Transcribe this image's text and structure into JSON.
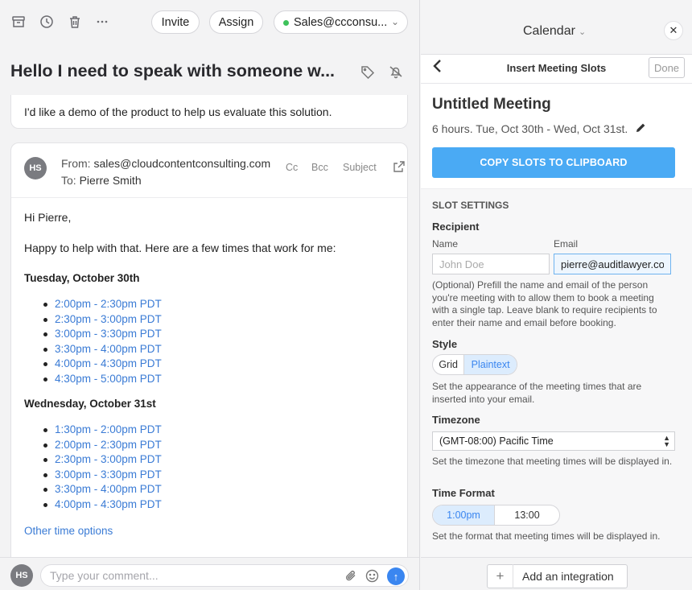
{
  "toolbar": {
    "archive_icon": "archive-icon",
    "snooze_icon": "clock-icon",
    "trash_icon": "trash-icon",
    "more_icon": "ellipsis-icon",
    "invite_label": "Invite",
    "assign_label": "Assign",
    "inbox_label": "Sales@ccconsu...",
    "inbox_status_color": "#3ec25b"
  },
  "conversation": {
    "subject": "Hello I need to speak with someone w...",
    "previous_message": "I'd like a demo of the product to help us evaluate this solution."
  },
  "message": {
    "avatar_initials": "HS",
    "from_label": "From:",
    "from_value": "sales@cloudcontentconsulting.com",
    "to_label": "To:",
    "to_value": "Pierre Smith",
    "cc_label": "Cc",
    "bcc_label": "Bcc",
    "subject_label": "Subject",
    "greeting": "Hi Pierre,",
    "intro": "Happy to help with that. Here are a few times that work for me:",
    "days": [
      {
        "title": "Tuesday, October 30th",
        "slots": [
          "2:00pm - 2:30pm PDT",
          "2:30pm - 3:00pm PDT",
          "3:00pm - 3:30pm PDT",
          "3:30pm - 4:00pm PDT",
          "4:00pm - 4:30pm PDT",
          "4:30pm - 5:00pm PDT"
        ]
      },
      {
        "title": "Wednesday, October 31st",
        "slots": [
          "1:30pm - 2:00pm PDT",
          "2:00pm - 2:30pm PDT",
          "2:30pm - 3:00pm PDT",
          "3:00pm - 3:30pm PDT",
          "3:30pm - 4:00pm PDT",
          "4:00pm - 4:30pm PDT"
        ]
      }
    ],
    "other_options": "Other time options"
  },
  "comment": {
    "avatar_initials": "HS",
    "placeholder": "Type your comment..."
  },
  "calendar": {
    "title": "Calendar",
    "subheader_title": "Insert Meeting Slots",
    "done_label": "Done",
    "meeting_title": "Untitled Meeting",
    "meeting_when": "6 hours. Tue, Oct 30th - Wed, Oct 31st.",
    "copy_button": "COPY SLOTS TO CLIPBOARD",
    "accent_color": "#4aaaf4",
    "slot_settings_heading": "SLOT SETTINGS",
    "recipient_label": "Recipient",
    "name_label": "Name",
    "name_placeholder": "John Doe",
    "email_label": "Email",
    "email_value": "pierre@auditlawyer.co",
    "recipient_help": "(Optional) Prefill the name and email of the person you're meeting with to allow them to book a meeting with a single tap. Leave blank to require recipients to enter their name and email before booking.",
    "style_label": "Style",
    "style_options": [
      "Grid",
      "Plaintext"
    ],
    "style_selected": "Plaintext",
    "style_help": "Set the appearance of the meeting times that are inserted into your email.",
    "timezone_label": "Timezone",
    "timezone_value": "(GMT-08:00) Pacific Time",
    "timezone_help": "Set the timezone that meeting times will be displayed in.",
    "time_format_label": "Time Format",
    "time_format_options": [
      "1:00pm",
      "13:00"
    ],
    "time_format_selected": "1:00pm",
    "time_format_help": "Set the format that meeting times will be displayed in.",
    "add_integration_label": "Add an integration"
  }
}
